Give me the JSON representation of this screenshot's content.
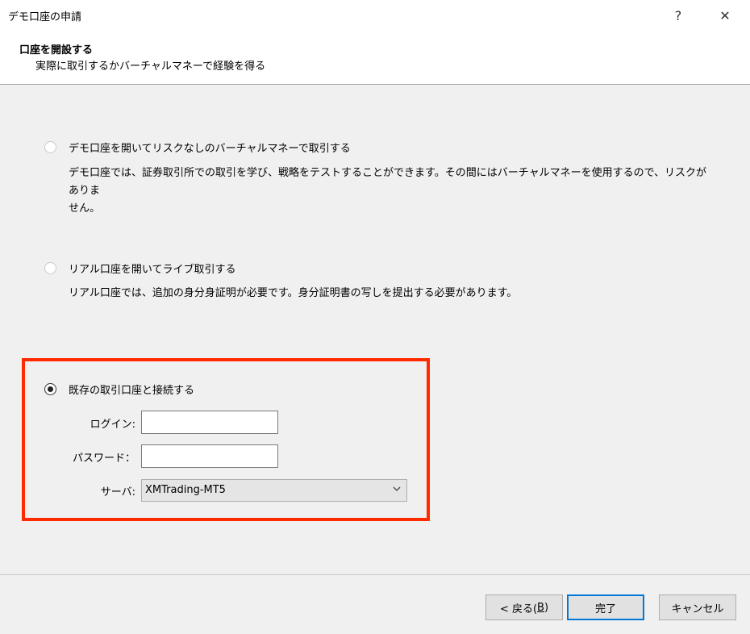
{
  "window": {
    "title": "デモ口座の申請",
    "help_label": "?",
    "close_label": "✕"
  },
  "header": {
    "title": "口座を開設する",
    "subtitle": "実際に取引するかバーチャルマネーで経験を得る"
  },
  "options": {
    "demo": {
      "label": "デモ口座を開いてリスクなしのバーチャルマネーで取引する",
      "desc_line1": "デモ口座では、証券取引所での取引を学び、戦略をテストすることができます。その間にはバーチャルマネーを使用するので、リスクがありま",
      "desc_line2": "せん。",
      "selected": false
    },
    "real": {
      "label": "リアル口座を開いてライブ取引する",
      "desc": "リアル口座では、追加の身分身証明が必要です。身分証明書の写しを提出する必要があります。",
      "selected": false
    },
    "existing": {
      "label": "既存の取引口座と接続する",
      "selected": true
    }
  },
  "form": {
    "login_label": "ログイン:",
    "login_value": "",
    "password_label": "パスワード：",
    "password_value": "",
    "server_label": "サーバ:",
    "server_value": "XMTrading-MT5"
  },
  "buttons": {
    "back_prefix": "< 戻る(",
    "back_key": "B",
    "back_suffix": ")",
    "finish": "完了",
    "cancel": "キャンセル"
  },
  "colors": {
    "highlight_border": "#ff2a00",
    "default_button_border": "#0078d7"
  }
}
